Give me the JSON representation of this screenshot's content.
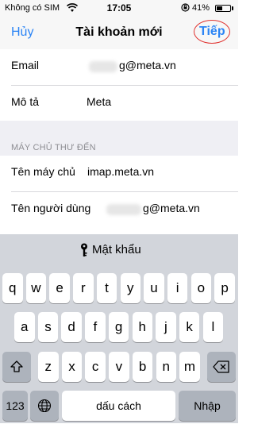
{
  "status_bar": {
    "carrier": "Không có SIM",
    "time": "17:05",
    "battery_percent": "41%",
    "battery_level": 0.41
  },
  "nav": {
    "cancel_label": "Hủy",
    "title": "Tài khoản mới",
    "next_label": "Tiếp"
  },
  "form": {
    "email": {
      "label": "Email",
      "value": "g@meta.vn"
    },
    "description": {
      "label": "Mô tả",
      "value": "Meta"
    },
    "incoming_header": "MÁY CHỦ THƯ ĐẾN",
    "host": {
      "label": "Tên máy chủ",
      "value": "imap.meta.vn"
    },
    "username": {
      "label": "Tên người dùng",
      "value": "g@meta.vn"
    }
  },
  "keyboard": {
    "suggestion": "Mật khẩu",
    "row1": [
      "q",
      "w",
      "e",
      "r",
      "t",
      "y",
      "u",
      "i",
      "o",
      "p"
    ],
    "row2": [
      "a",
      "s",
      "d",
      "f",
      "g",
      "h",
      "j",
      "k",
      "l"
    ],
    "row3": [
      "z",
      "x",
      "c",
      "v",
      "b",
      "n",
      "m"
    ],
    "numbers_label": "123",
    "space_label": "dấu cách",
    "return_label": "Nhập"
  },
  "colors": {
    "accent": "#2b84f5",
    "highlight_ring": "#e0322f"
  }
}
